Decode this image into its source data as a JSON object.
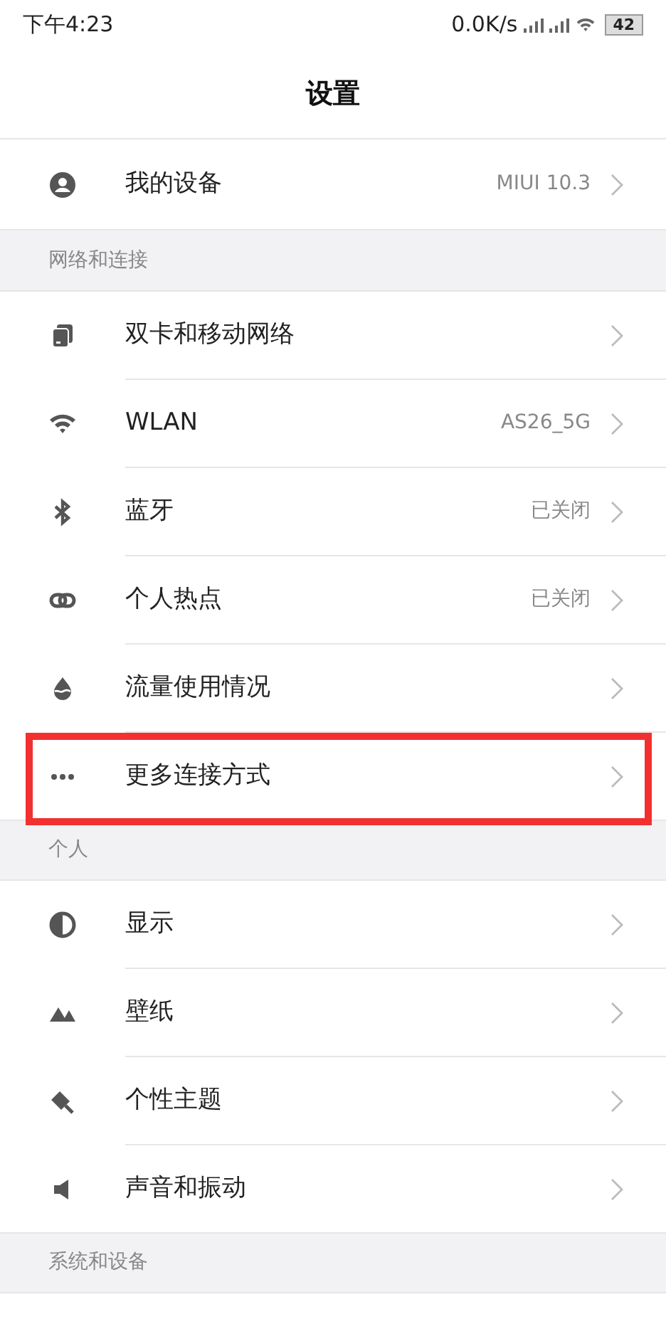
{
  "status_bar": {
    "time": "下午4:23",
    "speed": "0.0K/s",
    "battery": "42"
  },
  "title": "设置",
  "sections": [
    {
      "items": [
        {
          "label": "我的设备",
          "value": "MIUI 10.3",
          "highlighted": false
        }
      ]
    },
    {
      "header": "网络和连接",
      "items": [
        {
          "label": "双卡和移动网络",
          "highlighted": false
        },
        {
          "label": "WLAN",
          "value": "AS26_5G",
          "highlighted": false
        },
        {
          "label": "蓝牙",
          "value": "已关闭",
          "highlighted": false
        },
        {
          "label": "个人热点",
          "value": "已关闭",
          "highlighted": false
        },
        {
          "label": "流量使用情况",
          "highlighted": false
        },
        {
          "label": "更多连接方式",
          "highlighted": true
        }
      ]
    },
    {
      "header": "个人",
      "items": [
        {
          "label": "显示",
          "highlighted": false
        },
        {
          "label": "壁纸",
          "highlighted": false
        },
        {
          "label": "个性主题",
          "highlighted": false
        },
        {
          "label": "声音和振动",
          "highlighted": false
        }
      ]
    },
    {
      "header": "系统和设备"
    }
  ]
}
